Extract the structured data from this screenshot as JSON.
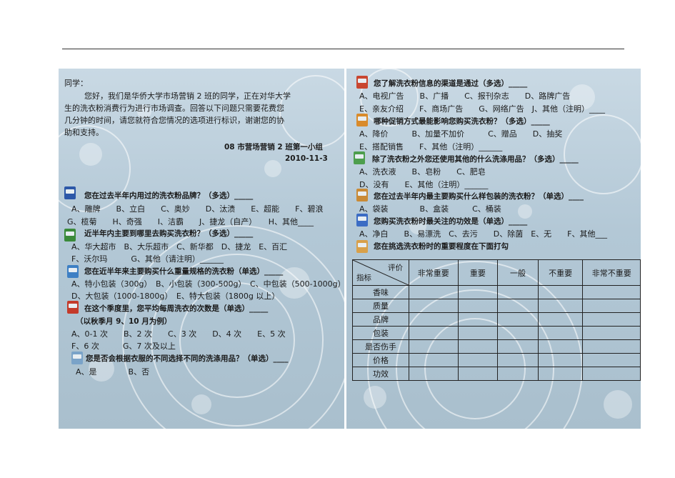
{
  "intro": {
    "greeting": "同学：",
    "lines": [
      "您好，我们是华侨大学市场营销 2 班的同学，正在对华大学",
      "生的洗衣粉消费行为进行市场调查。回答以下问题只需要花费您",
      "几分钟的时间，请您就符合您情况的选项进行标识，谢谢您的协",
      "助和支持。"
    ],
    "group": "08 市营场营销 2 班第一小组",
    "date": "2010-11-3"
  },
  "left_questions": [
    {
      "q": "您在过去半年内用过的洗衣粉品牌？（多选）_____",
      "opts": [
        "A、雕牌　　B、立白　　C、奥妙　　D、汰渍　　E、超能　　F、碧浪",
        "G、榄菊　　H、奇强　　I、洁霸　　J、捷龙（自产）　　H、其他____"
      ]
    },
    {
      "q": "近半年内主要到哪里去购买洗衣粉？（多选）_____",
      "opts": [
        "A、华大超市　B、大乐超市　C、新华都　D、捷龙　E、百汇",
        "F、沃尔玛　　　G、其他（请注明）______"
      ]
    },
    {
      "q": "您在近半年来主要购买什么重量规格的洗衣粉（单选）_____",
      "opts": [
        "A、特小包装（300g）　B、小包装（300-500g）　C、中包装（500-1000g）",
        "D、大包装（1000-1800g）　E、特大包装（1800g 以上）"
      ]
    },
    {
      "q": "在这个季度里，您平均每周洗衣的次数是（单选）_____",
      "opts": [
        "（以秋季月 9、10 月为例）",
        "A、0-1 次　　B、2 次　　C、3 次　　D、4 次　　E、5 次",
        "F、6 次　　　G、7 次及以上"
      ]
    },
    {
      "q": "您是否会根据衣服的不同选择不同的洗涤用品？（单选）____",
      "opts": [
        "A、是　　　　B、否"
      ]
    }
  ],
  "right_questions": [
    {
      "q": "您了解洗衣粉信息的渠道是通过（多选）_____",
      "opts": [
        "A、电视广告　　B、广播　　C、报刊杂志　　D、路牌广告",
        "E、亲友介绍　　F、商场广告　　G、网络广告　J、其他（注明）____"
      ]
    },
    {
      "q": "哪种促销方式最能影响您购买洗衣粉？（多选）_____",
      "opts": [
        "A、降价　　　B、加量不加价　　　C、赠品　　D、抽奖",
        "E、搭配销售　　F、其他（注明）______"
      ]
    },
    {
      "q": "除了洗衣粉之外您还使用其他的什么洗涤用品？（多选）_____",
      "opts": [
        "A、洗衣液　　B、皂粉　　C、肥皂",
        "D、没有　　E、其他（注明）______"
      ]
    },
    {
      "q": "您在过去半年内最主要购买什么样包装的洗衣粉？（单选）____",
      "opts": [
        "A、袋装　　　　B、盒装　　　C、桶装"
      ]
    },
    {
      "q": "您购买洗衣粉时最关注的功效是（单选）_____",
      "opts": [
        "A、净白　　B、易漂洗　C、去污　　D、除菌　E、无　　F、其他___"
      ]
    },
    {
      "q": "您在挑选洗衣粉时的重要程度在下面打勾",
      "opts": []
    }
  ],
  "table": {
    "corner_top": "评价",
    "corner_bottom": "指标",
    "columns": [
      "非常重要",
      "重要",
      "一般",
      "不重要",
      "非常不重要"
    ],
    "rows": [
      "香味",
      "质量",
      "品牌",
      "包装",
      "是否伤手",
      "价格",
      "功效"
    ]
  },
  "icon_colors": [
    "#2c57a8",
    "#3a8a3a",
    "#3d7fc4",
    "#c43a2a",
    "#7aa3c8",
    "#c9462f",
    "#d98b2b",
    "#4d9e4d",
    "#c98a36",
    "#3b6cc4",
    "#d9a049"
  ]
}
